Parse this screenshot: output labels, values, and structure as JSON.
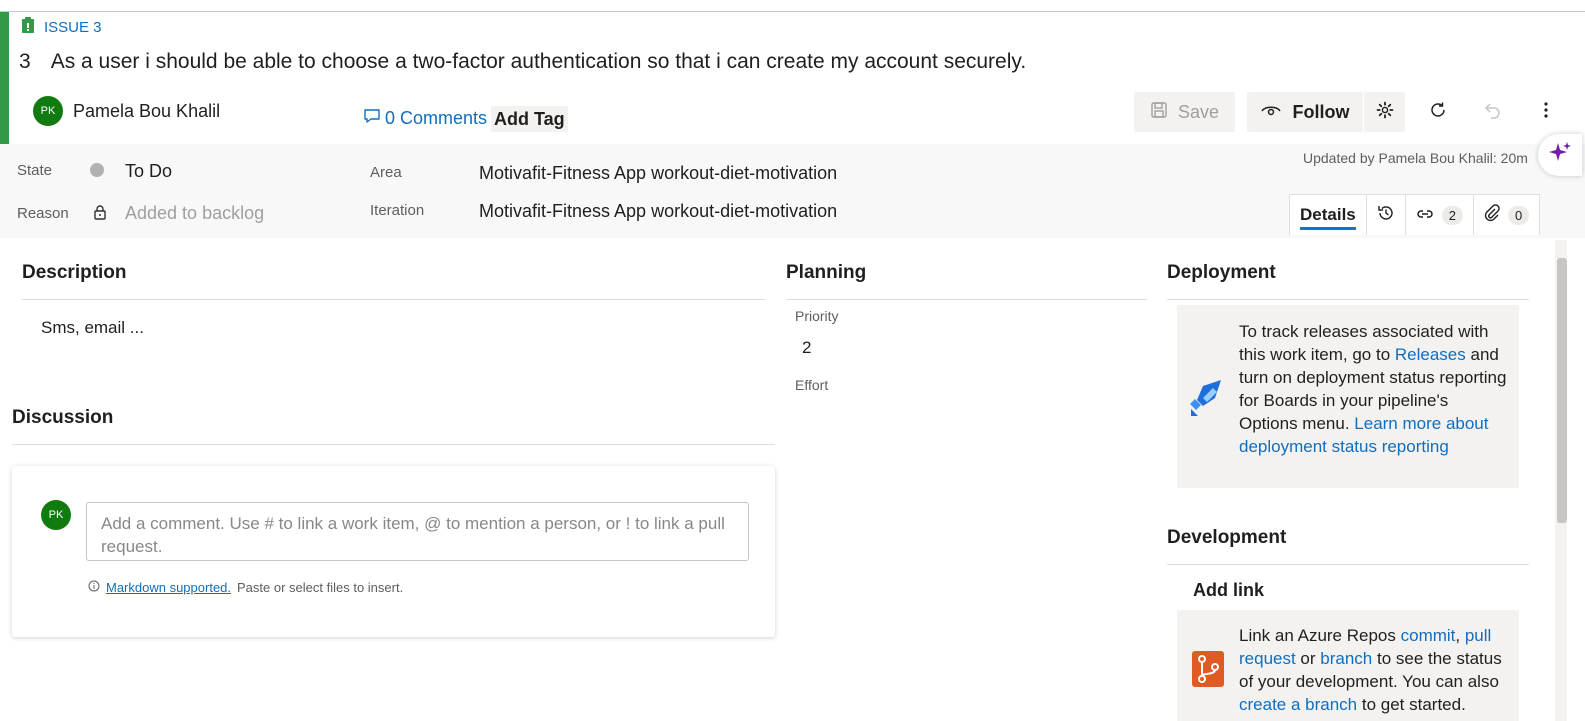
{
  "header": {
    "type_label": "ISSUE 3",
    "id": "3",
    "title": "As a user i should be able to choose a two-factor authentication so that i can create my account securely.",
    "assignee": {
      "initials": "PK",
      "name": "Pamela Bou Khalil"
    },
    "comments_link": "0 Comments",
    "add_tag": "Add Tag",
    "accent_color": "#339947"
  },
  "toolbar": {
    "save_label": "Save",
    "follow_label": "Follow"
  },
  "fields": {
    "state_label": "State",
    "state_value": "To Do",
    "reason_label": "Reason",
    "reason_value": "Added to backlog",
    "area_label": "Area",
    "area_value": "Motivafit-Fitness App workout-diet-motivation",
    "iteration_label": "Iteration",
    "iteration_value": "Motivafit-Fitness App workout-diet-motivation",
    "updated": "Updated by Pamela Bou Khalil: 20m"
  },
  "tabs": {
    "details": "Details",
    "links_count": "2",
    "attachments_count": "0"
  },
  "description": {
    "heading": "Description",
    "text": "Sms, email ..."
  },
  "discussion": {
    "heading": "Discussion",
    "avatar_initials": "PK",
    "placeholder": "Add a comment. Use # to link a work item, @ to mention a person, or ! to link a pull request.",
    "markdown_link": "Markdown supported.",
    "hint": "Paste or select files to insert."
  },
  "planning": {
    "heading": "Planning",
    "priority_label": "Priority",
    "priority_value": "2",
    "effort_label": "Effort"
  },
  "deployment": {
    "heading": "Deployment",
    "t1": "To track releases associated with this work item, go to ",
    "releases_link": "Releases",
    "t2": " and turn on deployment status reporting for Boards in your pipeline's Options menu. ",
    "learn_link": "Learn more about deployment status reporting"
  },
  "development": {
    "heading": "Development",
    "add_link": "Add link",
    "t1": "Link an Azure Repos ",
    "commit_link": "commit",
    "sep1": ", ",
    "pr_link": "pull request",
    "sep2": " or ",
    "branch_link": "branch",
    "t2": " to see the status of your development. You can also ",
    "create_branch_link": "create a branch",
    "t3": " to get started."
  }
}
